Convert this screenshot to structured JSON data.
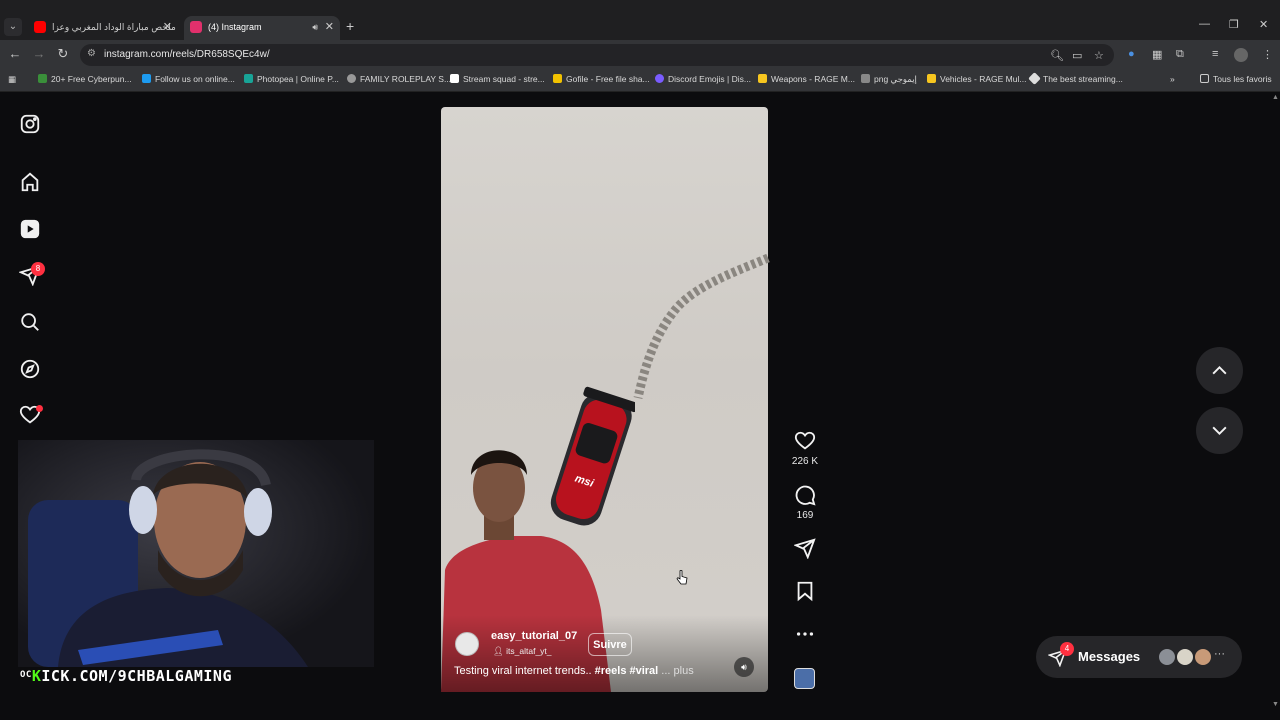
{
  "browser": {
    "tabs": [
      {
        "title": "ملخص مباراة الوداد المغربي وعزا",
        "favicon_color": "#ff0000"
      },
      {
        "title": "(4) Instagram",
        "favicon_color": "#e1306c",
        "active": true
      }
    ],
    "url": "instagram.com/reels/DR658SQEc4w/",
    "bookmarks": [
      {
        "label": "20+ Free Cyberpun...",
        "color": "#3a8f3a"
      },
      {
        "label": "Follow us on online...",
        "color": "#1d9bf0"
      },
      {
        "label": "Photopea | Online P...",
        "color": "#18a497"
      },
      {
        "label": "FAMILY ROLEPLAY S...",
        "color": "#999999"
      },
      {
        "label": "Stream squad - stre...",
        "color": "#ffffff"
      },
      {
        "label": "Gofile - Free file sha...",
        "color": "#f2c200"
      },
      {
        "label": "Discord Emojis | Dis...",
        "color": "#7a5cff"
      },
      {
        "label": "Weapons - RAGE M...",
        "color": "#f7c61f"
      },
      {
        "label": "png إيموجي",
        "color": "#888888"
      },
      {
        "label": "Vehicles - RAGE Mul...",
        "color": "#f7c61f"
      },
      {
        "label": "The best streaming...",
        "color": "#dddddd"
      }
    ],
    "all_bookmarks_label": "Tous les favoris"
  },
  "sidebar": {
    "notifications_badge": "8"
  },
  "reel": {
    "username": "easy_tutorial_07",
    "audio_user": "its_altaf_yt_",
    "follow_label": "Suivre",
    "caption_text": "Testing viral internet trends.. ",
    "caption_tags": "#reels #viral",
    "caption_more": " ... plus",
    "likes": "226 K",
    "comments": "169"
  },
  "messages": {
    "label": "Messages",
    "badge": "4"
  },
  "overlay": {
    "cam_prefix": "OC",
    "kick_k": "K",
    "kick_rest": "ICK.COM/9CHBALGAMING"
  }
}
